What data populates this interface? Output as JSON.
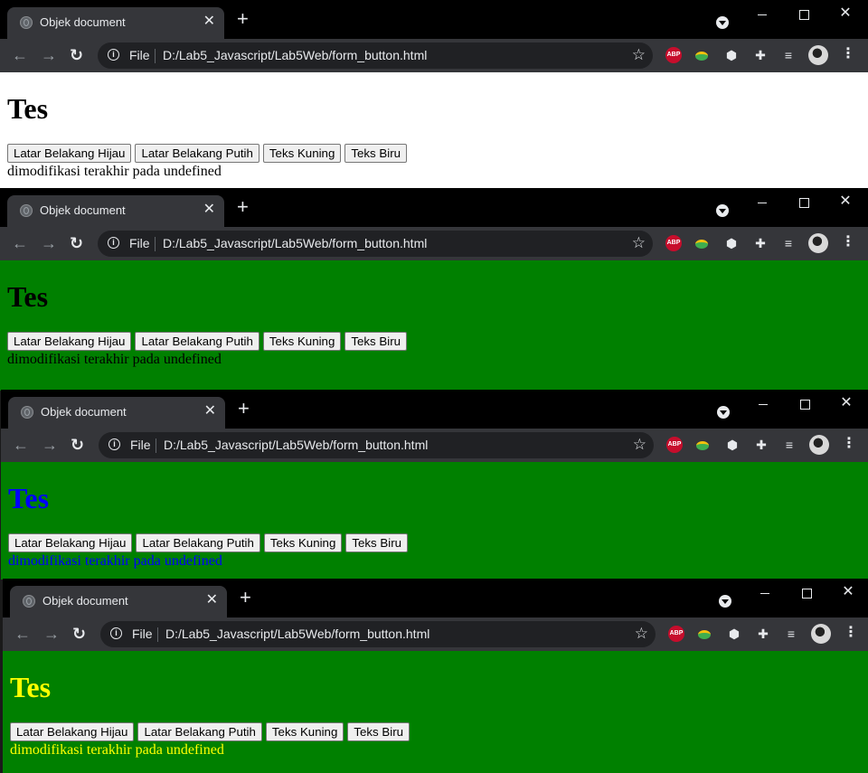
{
  "windows": [
    {
      "tab_title": "Objek document",
      "url_scheme": "File",
      "url": "D:/Lab5_Javascript/Lab5Web/form_button.html",
      "heading": "Tes",
      "buttons": [
        "Latar Belakang Hijau",
        "Latar Belakang Putih",
        "Teks Kuning",
        "Teks Biru"
      ],
      "status_text": "dimodifikasi terakhir pada undefined",
      "background": "#ffffff",
      "text_color": "#000000"
    },
    {
      "tab_title": "Objek document",
      "url_scheme": "File",
      "url": "D:/Lab5_Javascript/Lab5Web/form_button.html",
      "heading": "Tes",
      "buttons": [
        "Latar Belakang Hijau",
        "Latar Belakang Putih",
        "Teks Kuning",
        "Teks Biru"
      ],
      "status_text": "dimodifikasi terakhir pada undefined",
      "background": "#008000",
      "text_color": "#000000"
    },
    {
      "tab_title": "Objek document",
      "url_scheme": "File",
      "url": "D:/Lab5_Javascript/Lab5Web/form_button.html",
      "heading": "Tes",
      "buttons": [
        "Latar Belakang Hijau",
        "Latar Belakang Putih",
        "Teks Kuning",
        "Teks Biru"
      ],
      "status_text": "dimodifikasi terakhir pada undefined",
      "background": "#008000",
      "text_color": "#0000ff"
    },
    {
      "tab_title": "Objek document",
      "url_scheme": "File",
      "url": "D:/Lab5_Javascript/Lab5Web/form_button.html",
      "heading": "Tes",
      "buttons": [
        "Latar Belakang Hijau",
        "Latar Belakang Putih",
        "Teks Kuning",
        "Teks Biru"
      ],
      "status_text": "dimodifikasi terakhir pada undefined",
      "background": "#008000",
      "text_color": "#ffff00"
    }
  ],
  "icons": {
    "new_tab": "+",
    "close_tab": "✕",
    "back": "←",
    "forward": "→",
    "reload": "↻",
    "info": "i",
    "star": "☆",
    "abp": "ABP",
    "cube": "⬢",
    "puzzle": "✚",
    "media": "≡",
    "menu": "⋮",
    "close_window": "✕"
  }
}
